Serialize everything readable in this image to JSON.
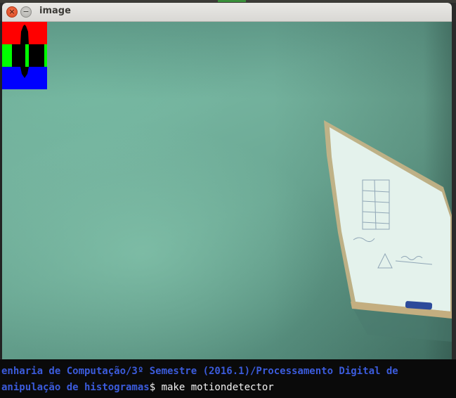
{
  "window": {
    "title": "image",
    "close_glyph": "×",
    "minimize_glyph": "−"
  },
  "histogram": {
    "channels": [
      "red",
      "green",
      "blue"
    ],
    "colors": {
      "red": "#ff0000",
      "green": "#00ff00",
      "blue": "#0000ff"
    }
  },
  "terminal": {
    "line1": "enharia de Computação/3º Semestre (2016.1)/Processamento Digital de",
    "line2_path": "anipulação de histogramas",
    "line2_prompt": "$ ",
    "line2_command": "make motiondetector"
  },
  "colors": {
    "title_bar": "#dedcd8",
    "terminal_bg": "#0a0a0a",
    "terminal_path": "#3b5bdb",
    "terminal_text": "#f2f2f2",
    "close_button": "#e65a30"
  }
}
